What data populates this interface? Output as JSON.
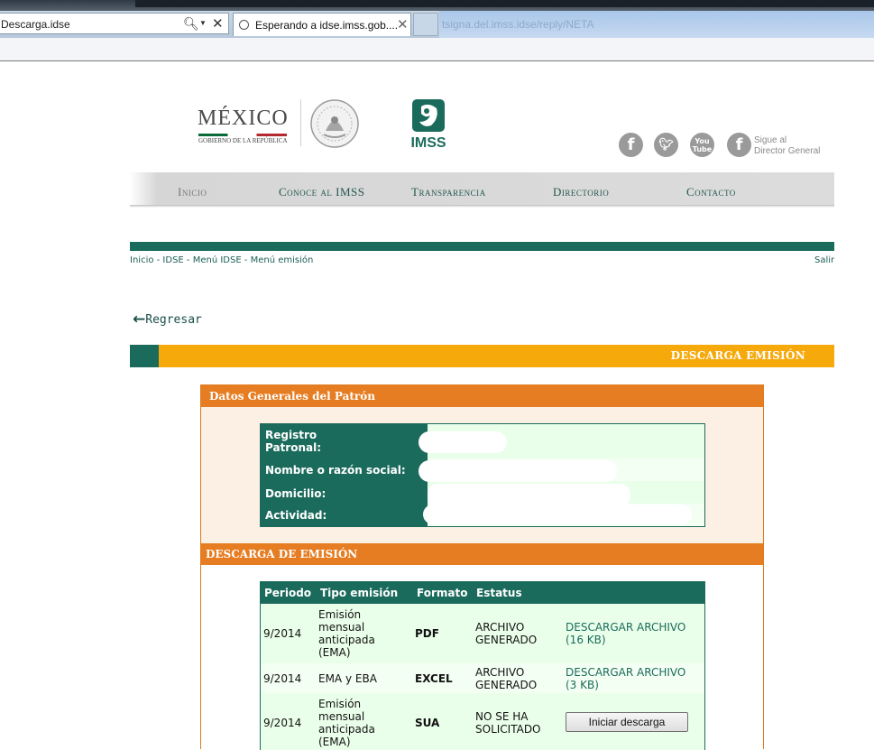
{
  "browser": {
    "address": "Descarga.idse",
    "tab_title": "Esperando a idse.imss.gob....",
    "ghost_url": "tsigna.del.imss.idse/reply/NETA"
  },
  "header": {
    "mexico_word": "MÉXICO",
    "mexico_sub": "GOBIERNO DE LA REPÚBLICA",
    "imss_word": "IMSS",
    "follow_text_1": "Sigue al",
    "follow_text_2": "Director General",
    "social_icons": [
      "facebook-icon",
      "twitter-icon",
      "youtube-icon",
      "facebook-icon"
    ],
    "youtube_top": "You",
    "youtube_bottom": "Tube"
  },
  "nav": {
    "items": [
      "Inicio",
      "Conoce al IMSS",
      "Transparencia",
      "Directorio",
      "Contacto"
    ]
  },
  "breadcrumb": "Inicio - IDSE - Menú IDSE - Menú emisión",
  "salir": "Salir",
  "regresar": "Regresar",
  "page_title": "DESCARGA EMISIÓN",
  "datos": {
    "header": "Datos Generales del Patrón",
    "labels": {
      "registro_1": "Registro",
      "registro_2": "Patronal:",
      "nombre": "Nombre o razón social:",
      "domicilio": "Domicilio:",
      "actividad": "Actividad:"
    }
  },
  "descarga": {
    "header": "DESCARGA DE EMISIÓN",
    "columns": [
      "Periodo",
      "Tipo emisión",
      "Formato",
      "Estatus"
    ],
    "rows": [
      {
        "periodo": "9/2014",
        "tipo": [
          "Emisión",
          "mensual",
          "anticipada",
          "(EMA)"
        ],
        "formato": "PDF",
        "estatus": [
          "ARCHIVO",
          "GENERADO"
        ],
        "accion": [
          "DESCARGAR ARCHIVO",
          "(16 KB)"
        ]
      },
      {
        "periodo": "9/2014",
        "tipo": [
          "EMA y EBA"
        ],
        "formato": "EXCEL",
        "estatus": [
          "ARCHIVO",
          "GENERADO"
        ],
        "accion": [
          "DESCARGAR ARCHIVO",
          "(3 KB)"
        ]
      },
      {
        "periodo": "9/2014",
        "tipo": [
          "Emisión",
          "mensual",
          "anticipada",
          "(EMA)"
        ],
        "formato": "SUA",
        "estatus": [
          "NO SE HA",
          "SOLICITADO"
        ],
        "button": "Iniciar descarga"
      }
    ]
  },
  "colors": {
    "green": "#1b6b5c",
    "orange": "#e67d22",
    "yellow": "#f6a90b",
    "light_green": "#eaffea",
    "peach": "#fcefe3"
  }
}
